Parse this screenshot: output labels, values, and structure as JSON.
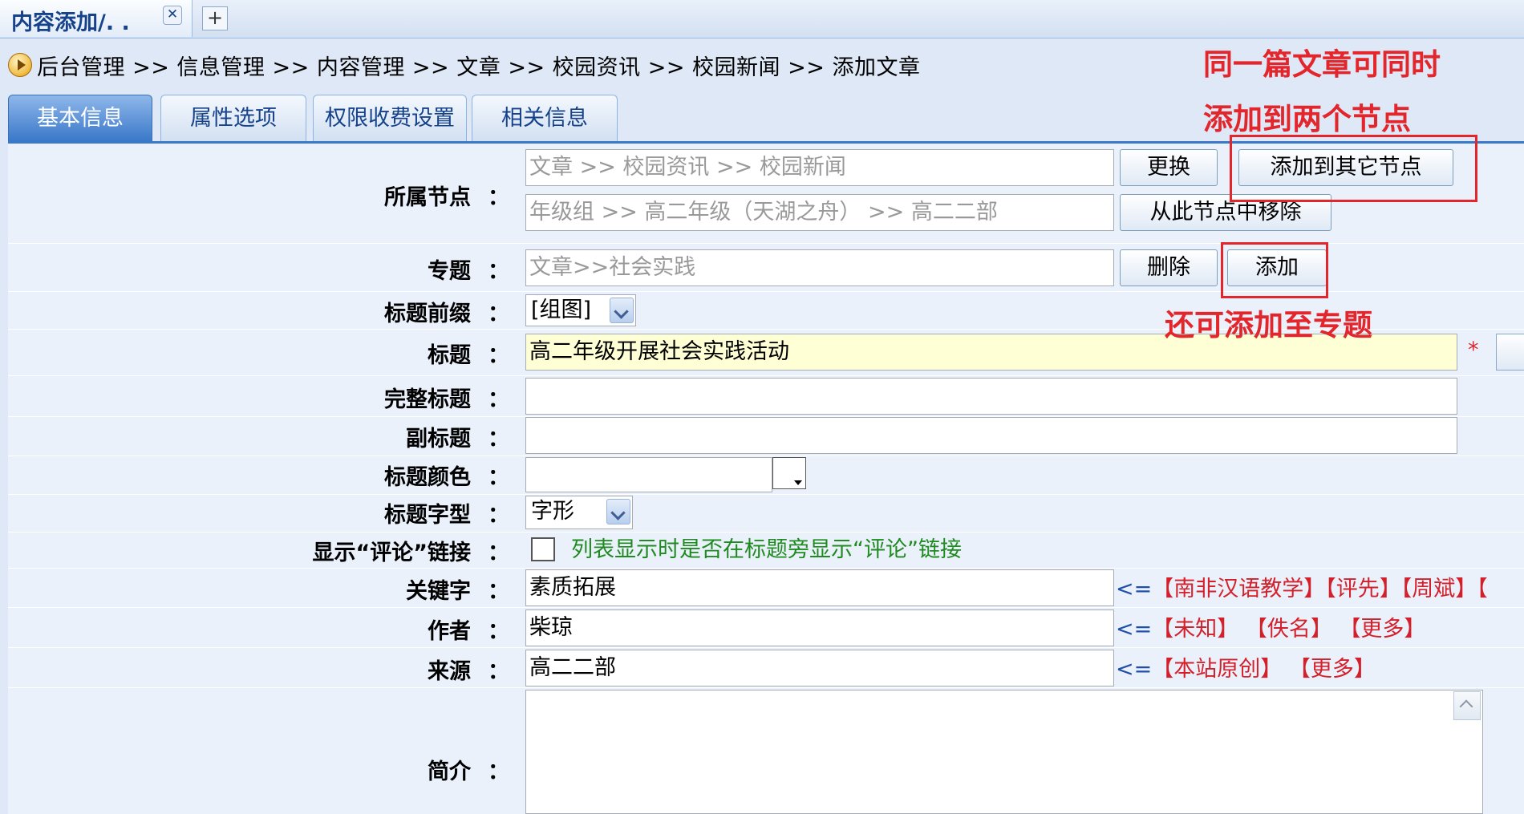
{
  "tab_strip": {
    "active_tab_title": "内容添加/. .",
    "close_glyph": "✕",
    "new_tab_glyph": "+"
  },
  "breadcrumb": {
    "path": "后台管理 >> 信息管理 >> 内容管理 >> 文章 >> 校园资讯 >> 校园新闻 >> 添加文章"
  },
  "annotations": {
    "note1_line1": "同一篇文章可同时",
    "note1_line2": "添加到两个节点",
    "note2": "还可添加至专题"
  },
  "form_tabs": [
    {
      "label": "基本信息",
      "active": true
    },
    {
      "label": "属性选项",
      "active": false
    },
    {
      "label": "权限收费设置",
      "active": false
    },
    {
      "label": "相关信息",
      "active": false
    }
  ],
  "form": {
    "colon": "：",
    "node": {
      "label": "所属节点",
      "value1": "文章 >> 校园资讯 >> 校园新闻",
      "value2": "年级组 >> 高二年级（天湖之舟） >> 高二二部",
      "change_btn": "更换",
      "add_other_btn": "添加到其它节点",
      "remove_btn": "从此节点中移除"
    },
    "topic": {
      "label": "专题",
      "value": "文章>>社会实践",
      "delete_btn": "删除",
      "add_btn": "添加"
    },
    "title_prefix": {
      "label": "标题前缀",
      "value": "[组图]"
    },
    "title": {
      "label": "标题",
      "value": "高二年级开展社会实践活动",
      "required_mark": "*"
    },
    "full_title": {
      "label": "完整标题",
      "value": ""
    },
    "subtitle": {
      "label": "副标题",
      "value": ""
    },
    "title_color": {
      "label": "标题颜色",
      "value": ""
    },
    "title_font": {
      "label": "标题字型",
      "value": "字形"
    },
    "show_comment": {
      "label": "显示“评论”链接",
      "hint": "列表显示时是否在标题旁显示“评论”链接"
    },
    "keywords": {
      "label": "关键字",
      "value": "素质拓展",
      "arrow": "<=",
      "quick": [
        "【南非汉语教学】",
        "【评先】",
        "【周斌】",
        "【"
      ]
    },
    "author": {
      "label": "作者",
      "value": "柴琼",
      "arrow": "<=",
      "quick": [
        "【未知】",
        "【佚名】",
        "【更多】"
      ]
    },
    "source": {
      "label": "来源",
      "value": "高二二部",
      "arrow": "<=",
      "quick": [
        "【本站原创】",
        "【更多】"
      ]
    },
    "intro": {
      "label": "简介",
      "value": ""
    }
  },
  "colors": {
    "accent": "#3a78c9",
    "annotation_red": "#e3262b",
    "quick_link_red": "#d3202a",
    "hint_green": "#1f8a1f",
    "title_bg_yellow": "#ffffd6"
  }
}
